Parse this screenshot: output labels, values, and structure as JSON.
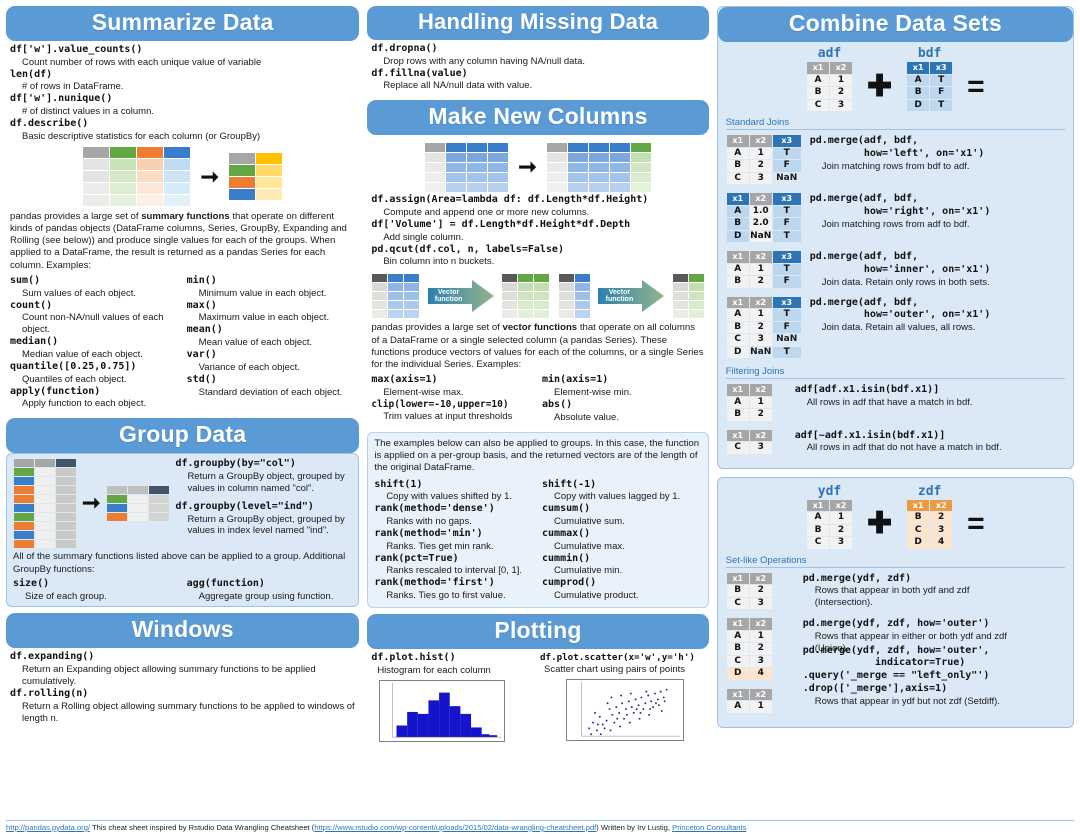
{
  "sections": {
    "summarize": {
      "title": "Summarize Data",
      "items": [
        {
          "fn": "df['w'].value_counts()",
          "desc": "Count number of rows with each unique value of variable"
        },
        {
          "fn": "len(df)",
          "desc": "# of rows in DataFrame."
        },
        {
          "fn": "df['w'].nunique()",
          "desc": "# of distinct values in a column."
        },
        {
          "fn": "df.describe()",
          "desc": "Basic descriptive statistics for each column (or GroupBy)"
        }
      ],
      "paragraph_pre": "pandas provides a large set of ",
      "paragraph_bold": "summary functions",
      "paragraph_post": " that operate on different kinds of pandas objects (DataFrame columns, Series, GroupBy, Expanding and Rolling (see below)) and produce single values for each of the groups. When applied to a DataFrame, the result is returned as a pandas Series for each column. Examples:",
      "left_items": [
        {
          "fn": "sum()",
          "desc": "Sum values of each object."
        },
        {
          "fn": "count()",
          "desc": "Count non-NA/null values of each object."
        },
        {
          "fn": "median()",
          "desc": "Median value of each object."
        },
        {
          "fn": "quantile([0.25,0.75])",
          "desc": "Quantiles of each object."
        },
        {
          "fn": "apply(function)",
          "desc": "Apply function to each object."
        }
      ],
      "right_items": [
        {
          "fn": "min()",
          "desc": "Minimum value in each object."
        },
        {
          "fn": "max()",
          "desc": "Maximum value in each object."
        },
        {
          "fn": "mean()",
          "desc": "Mean value of each object."
        },
        {
          "fn": "var()",
          "desc": "Variance of each object."
        },
        {
          "fn": "std()",
          "desc": "Standard deviation of each object."
        }
      ]
    },
    "group": {
      "title": "Group Data",
      "items": [
        {
          "fn": "df.groupby(by=\"col\")",
          "desc": "Return a GroupBy object, grouped by values in column named \"col\"."
        },
        {
          "fn": "df.groupby(level=\"ind\")",
          "desc": "Return a GroupBy object, grouped by values in index level named \"ind\"."
        }
      ],
      "note": "All of the summary functions listed above can be applied to a group. Additional GroupBy functions:",
      "left_items": [
        {
          "fn": "size()",
          "desc": "Size of each group."
        }
      ],
      "right_items": [
        {
          "fn": "agg(function)",
          "desc": "Aggregate group using function."
        }
      ]
    },
    "windows": {
      "title": "Windows",
      "items": [
        {
          "fn": "df.expanding()",
          "desc": "Return an Expanding object allowing summary functions to be applied cumulatively."
        },
        {
          "fn": "df.rolling(n)",
          "desc": "Return a Rolling object allowing summary functions to be applied to windows of length n."
        }
      ]
    },
    "missing": {
      "title": "Handling Missing Data",
      "items": [
        {
          "fn": "df.dropna()",
          "desc": "Drop rows with any column having NA/null data."
        },
        {
          "fn": "df.fillna(value)",
          "desc": "Replace all NA/null data with value."
        }
      ]
    },
    "newcols": {
      "title": "Make New Columns",
      "items": [
        {
          "fn": "df.assign(Area=lambda df: df.Length*df.Height)",
          "desc": "Compute and append one or more new columns."
        },
        {
          "fn": "df['Volume'] = df.Length*df.Height*df.Depth",
          "desc": "Add single column."
        },
        {
          "fn": "pd.qcut(df.col, n, labels=False)",
          "desc": "Bin column into n buckets."
        }
      ],
      "vector_label_line1": "Vector",
      "vector_label_line2": "function",
      "paragraph_pre": "pandas provides a large set of ",
      "paragraph_bold": "vector functions",
      "paragraph_post": " that operate on all columns of a DataFrame or a single selected column (a pandas Series). These functions produce vectors of values for each of the columns, or a single Series for the individual Series. Examples:",
      "left_items": [
        {
          "fn": "max(axis=1)",
          "desc": "Element-wise max."
        },
        {
          "fn": "clip(lower=-10,upper=10)",
          "desc": "Trim values at input thresholds"
        }
      ],
      "right_items": [
        {
          "fn": "min(axis=1)",
          "desc": "Element-wise min."
        },
        {
          "fn": "abs()",
          "desc": "Absolute value."
        }
      ]
    },
    "groupapply": {
      "note": "The examples below can also be applied to groups. In this case, the function is applied on a per-group basis, and the returned vectors are of the length of the original DataFrame.",
      "left_items": [
        {
          "fn": "shift(1)",
          "desc": "Copy with values shifted by 1."
        },
        {
          "fn": "rank(method='dense')",
          "desc": "Ranks with no gaps."
        },
        {
          "fn": "rank(method='min')",
          "desc": "Ranks. Ties get min rank."
        },
        {
          "fn": "rank(pct=True)",
          "desc": "Ranks rescaled to interval [0, 1]."
        },
        {
          "fn": "rank(method='first')",
          "desc": "Ranks. Ties go to first value."
        }
      ],
      "right_items": [
        {
          "fn": "shift(-1)",
          "desc": "Copy with values lagged by 1."
        },
        {
          "fn": "cumsum()",
          "desc": "Cumulative sum."
        },
        {
          "fn": "cummax()",
          "desc": "Cumulative max."
        },
        {
          "fn": "cummin()",
          "desc": "Cumulative min."
        },
        {
          "fn": "cumprod()",
          "desc": "Cumulative product."
        }
      ]
    },
    "plotting": {
      "title": "Plotting",
      "left": {
        "fn": "df.plot.hist()",
        "desc": "Histogram for each column"
      },
      "right": {
        "fn": "df.plot.scatter(x='w',y='h')",
        "desc": "Scatter chart using pairs of points"
      }
    },
    "combine": {
      "title": "Combine Data Sets",
      "adf_name": "adf",
      "bdf_name": "bdf",
      "ydf_name": "ydf",
      "zdf_name": "zdf",
      "plus": "➕",
      "equals": "=",
      "standard_joins_label": "Standard Joins",
      "filtering_joins_label": "Filtering Joins",
      "setlike_label": "Set-like Operations",
      "adf": {
        "headers": [
          "x1",
          "x2"
        ],
        "rows": [
          [
            "A",
            "1"
          ],
          [
            "B",
            "2"
          ],
          [
            "C",
            "3"
          ]
        ]
      },
      "bdf": {
        "headers": [
          "x1",
          "x3"
        ],
        "rows": [
          [
            "A",
            "T"
          ],
          [
            "B",
            "F"
          ],
          [
            "D",
            "T"
          ]
        ]
      },
      "ydf": {
        "headers": [
          "x1",
          "x2"
        ],
        "rows": [
          [
            "A",
            "1"
          ],
          [
            "B",
            "2"
          ],
          [
            "C",
            "3"
          ]
        ]
      },
      "zdf": {
        "headers": [
          "x1",
          "x2"
        ],
        "rows": [
          [
            "B",
            "2"
          ],
          [
            "C",
            "3"
          ],
          [
            "D",
            "4"
          ]
        ]
      },
      "joins": [
        {
          "headers": [
            "x1",
            "x2",
            "x3"
          ],
          "rows": [
            [
              "A",
              "1",
              "T"
            ],
            [
              "B",
              "2",
              "F"
            ],
            [
              "C",
              "3",
              "NaN"
            ]
          ],
          "code_line1": "pd.merge(adf, bdf,",
          "code_line2": "         how='left', on='x1')",
          "desc": "Join matching rows from bdf to adf."
        },
        {
          "headers": [
            "x1",
            "x2",
            "x3"
          ],
          "rows": [
            [
              "A",
              "1.0",
              "T"
            ],
            [
              "B",
              "2.0",
              "F"
            ],
            [
              "D",
              "NaN",
              "T"
            ]
          ],
          "code_line1": "pd.merge(adf, bdf,",
          "code_line2": "         how='right', on='x1')",
          "desc": "Join matching rows from adf to bdf."
        },
        {
          "headers": [
            "x1",
            "x2",
            "x3"
          ],
          "rows": [
            [
              "A",
              "1",
              "T"
            ],
            [
              "B",
              "2",
              "F"
            ]
          ],
          "code_line1": "pd.merge(adf, bdf,",
          "code_line2": "         how='inner', on='x1')",
          "desc": "Join data. Retain only rows in both sets."
        },
        {
          "headers": [
            "x1",
            "x2",
            "x3"
          ],
          "rows": [
            [
              "A",
              "1",
              "T"
            ],
            [
              "B",
              "2",
              "F"
            ],
            [
              "C",
              "3",
              "NaN"
            ],
            [
              "D",
              "NaN",
              "T"
            ]
          ],
          "code_line1": "pd.merge(adf, bdf,",
          "code_line2": "         how='outer', on='x1')",
          "desc": "Join data. Retain all values, all rows."
        }
      ],
      "filtering": [
        {
          "headers": [
            "x1",
            "x2"
          ],
          "rows": [
            [
              "A",
              "1"
            ],
            [
              "B",
              "2"
            ]
          ],
          "code_line1": "adf[adf.x1.isin(bdf.x1)]",
          "desc": "All rows in adf that have a match in bdf."
        },
        {
          "headers": [
            "x1",
            "x2"
          ],
          "rows": [
            [
              "C",
              "3"
            ]
          ],
          "code_line1": "adf[~adf.x1.isin(bdf.x1)]",
          "desc": "All rows in adf that do not have a match in bdf."
        }
      ],
      "setlike": [
        {
          "headers": [
            "x1",
            "x2"
          ],
          "rows": [
            [
              "B",
              "2"
            ],
            [
              "C",
              "3"
            ]
          ],
          "code_line1": "pd.merge(ydf, zdf)",
          "desc1": "Rows that appear in both ydf and zdf",
          "desc2": "(Intersection)."
        },
        {
          "headers": [
            "x1",
            "x2"
          ],
          "rows": [
            [
              "A",
              "1"
            ],
            [
              "B",
              "2"
            ],
            [
              "C",
              "3"
            ],
            [
              "D",
              "4"
            ]
          ],
          "code_line1": "pd.merge(ydf, zdf, how='outer')",
          "desc1": "Rows that appear in either or both ydf and zdf",
          "desc2": "(Union)."
        },
        {
          "headers": [
            "x1",
            "x2"
          ],
          "rows": [
            [
              "A",
              "1"
            ]
          ],
          "code_line1": "pd.merge(ydf, zdf, how='outer',",
          "code_line2": "            indicator=True)",
          "code_line3": ".query('_merge == \"left_only\"')",
          "code_line4": ".drop(['_merge'],axis=1)",
          "desc1": "Rows that appear in ydf but not zdf (Setdiff)."
        }
      ]
    }
  },
  "footer": {
    "url": "http://pandas.pydata.org/",
    "text1": "This cheat sheet inspired by Rstudio Data Wrangling Cheatsheet (",
    "url2": "https://www.rstudio.com/wp-content/uploads/2015/02/data-wrangling-cheatsheet.pdf",
    "text2": ") Written by Irv Lustig, ",
    "url3": "Princeton Consultants"
  },
  "colors": {
    "banner": "#5b9bd5",
    "panel": "#dbe9f7",
    "accent": "#2e75b6",
    "gray_header": "#a6a6a6",
    "orange_header": "#ed9b43"
  }
}
